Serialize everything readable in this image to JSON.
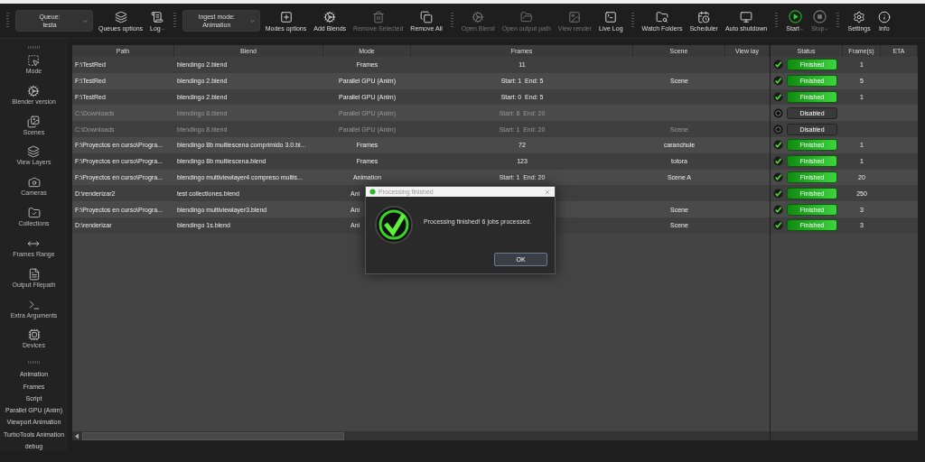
{
  "toolbar": {
    "groups": [
      {
        "items": [
          {
            "kind": "dropdown",
            "label": "Queue:",
            "value": "testa"
          },
          {
            "kind": "tool",
            "label": "Queues options",
            "disabled": false,
            "caret": false
          },
          {
            "kind": "tool",
            "label": "Log",
            "disabled": false,
            "caret": true
          }
        ]
      },
      {
        "items": [
          {
            "kind": "dropdown",
            "label": "Ingest mode:",
            "value": "Animation"
          },
          {
            "kind": "tool",
            "label": "Modes options",
            "disabled": false,
            "caret": false
          },
          {
            "kind": "tool",
            "label": "Add Blends",
            "disabled": false,
            "caret": false
          },
          {
            "kind": "tool",
            "label": "Remove Selected",
            "disabled": true,
            "caret": false
          },
          {
            "kind": "tool",
            "label": "Remove All",
            "disabled": false,
            "caret": false
          }
        ]
      },
      {
        "items": [
          {
            "kind": "tool",
            "label": "Open Blend",
            "disabled": true,
            "caret": false
          },
          {
            "kind": "tool",
            "label": "Open output path",
            "disabled": true,
            "caret": false
          },
          {
            "kind": "tool",
            "label": "View render",
            "disabled": true,
            "caret": false
          },
          {
            "kind": "tool",
            "label": "Live Log",
            "disabled": false,
            "caret": false
          }
        ]
      },
      {
        "items": [
          {
            "kind": "tool",
            "label": "Watch Folders",
            "disabled": false,
            "caret": false
          },
          {
            "kind": "tool",
            "label": "Scheduler",
            "disabled": false,
            "caret": false
          },
          {
            "kind": "tool",
            "label": "Auto shutdown",
            "disabled": false,
            "caret": false
          }
        ]
      },
      {
        "items": [
          {
            "kind": "tool",
            "label": "Start",
            "disabled": false,
            "caret": true
          },
          {
            "kind": "tool",
            "label": "Stop",
            "disabled": true,
            "caret": true
          }
        ]
      },
      {
        "items": [
          {
            "kind": "tool",
            "label": "Settings",
            "disabled": false,
            "caret": false
          },
          {
            "kind": "tool",
            "label": "Info",
            "disabled": false,
            "caret": false
          }
        ]
      }
    ]
  },
  "sidebar": {
    "icon_items": [
      "Mode",
      "Blender version",
      "Scenes",
      "View Layers",
      "Cameras",
      "Collections",
      "Frames Range",
      "Output Filepath",
      "Extra Arguments",
      "Devices"
    ],
    "mode_items": [
      "Animation",
      "Frames",
      "Script",
      "Parallel GPU (Anim)",
      "Viewport Animation",
      "TurboTools Animation",
      "debug"
    ]
  },
  "table": {
    "columns": [
      "Path",
      "Blend",
      "Mode",
      "Frames",
      "Scene",
      "View lay"
    ],
    "rows": [
      {
        "path": "F:\\TestRed",
        "blend": "blendingo 2.blend",
        "mode": "Frames",
        "frames": "11",
        "scene": "",
        "disabled": false,
        "mode_cut": false
      },
      {
        "path": "F:\\TestRed",
        "blend": "blendingo 2.blend",
        "mode": "Parallel GPU (Anim)",
        "frames": "Start: 1  End: 5",
        "scene": "Scene",
        "disabled": false,
        "mode_cut": false
      },
      {
        "path": "F:\\TestRed",
        "blend": "blendingo 2.blend",
        "mode": "Parallel GPU (Anim)",
        "frames": "Start: 0  End: 5",
        "scene": "",
        "disabled": false,
        "mode_cut": false
      },
      {
        "path": "C:\\Downloads",
        "blend": "blendingo 8.blend",
        "mode": "Parallel GPU (Anim)",
        "frames": "Start: 8  End: 20",
        "scene": "",
        "disabled": true,
        "mode_cut": false
      },
      {
        "path": "C:\\Downloads",
        "blend": "blendingo 8.blend",
        "mode": "Parallel GPU (Anim)",
        "frames": "Start: 1  End: 20",
        "scene": "Scene",
        "disabled": true,
        "mode_cut": false
      },
      {
        "path": "F:\\Proyectos en curso\\Progra...",
        "blend": "blendingo 8b multiescena comprimido 3.0.bl...",
        "mode": "Frames",
        "frames": "72",
        "scene": "caranchule",
        "disabled": false,
        "mode_cut": false
      },
      {
        "path": "F:\\Proyectos en curso\\Progra...",
        "blend": "blendingo 8b multiescena.blend",
        "mode": "Frames",
        "frames": "123",
        "scene": "totora",
        "disabled": false,
        "mode_cut": false
      },
      {
        "path": "F:\\Proyectos en curso\\Progra...",
        "blend": "blendingo multiviewlayer4 compreso multis...",
        "mode": "Animation",
        "frames": "Start: 1  End: 20",
        "scene": "Scene A",
        "disabled": false,
        "mode_cut": false
      },
      {
        "path": "D:\\renderizar2",
        "blend": "test collectiones.blend",
        "mode": "Ani",
        "frames": "",
        "scene": "",
        "disabled": false,
        "mode_cut": true
      },
      {
        "path": "F:\\Proyectos en curso\\Progra...",
        "blend": "blendingo multiviewlayer3.blend",
        "mode": "Ani",
        "frames": "",
        "scene": "Scene",
        "disabled": false,
        "mode_cut": true
      },
      {
        "path": "D:\\renderizar",
        "blend": "blendingo 1s.blend",
        "mode": "Ani",
        "frames": "",
        "scene": "Scene",
        "disabled": false,
        "mode_cut": true
      }
    ]
  },
  "status_panel": {
    "columns": [
      "Status",
      "Frame(s)",
      "ETA"
    ],
    "rows": [
      {
        "status": "Finished",
        "kind": "finished",
        "frames": "1"
      },
      {
        "status": "Finished",
        "kind": "finished",
        "frames": "5"
      },
      {
        "status": "Finished",
        "kind": "finished",
        "frames": "1"
      },
      {
        "status": "Disabled",
        "kind": "disabled",
        "frames": ""
      },
      {
        "status": "Disabled",
        "kind": "disabled",
        "frames": ""
      },
      {
        "status": "Finished",
        "kind": "finished",
        "frames": "1"
      },
      {
        "status": "Finished",
        "kind": "finished",
        "frames": "1"
      },
      {
        "status": "Finished",
        "kind": "finished",
        "frames": "20"
      },
      {
        "status": "Finished",
        "kind": "finished",
        "frames": "250"
      },
      {
        "status": "Finished",
        "kind": "finished",
        "frames": "3"
      },
      {
        "status": "Finished",
        "kind": "finished",
        "frames": "3"
      }
    ]
  },
  "dialog": {
    "title": "Processing finished",
    "message": "Processing finished! 6 jobs processed.",
    "button": "OK"
  }
}
